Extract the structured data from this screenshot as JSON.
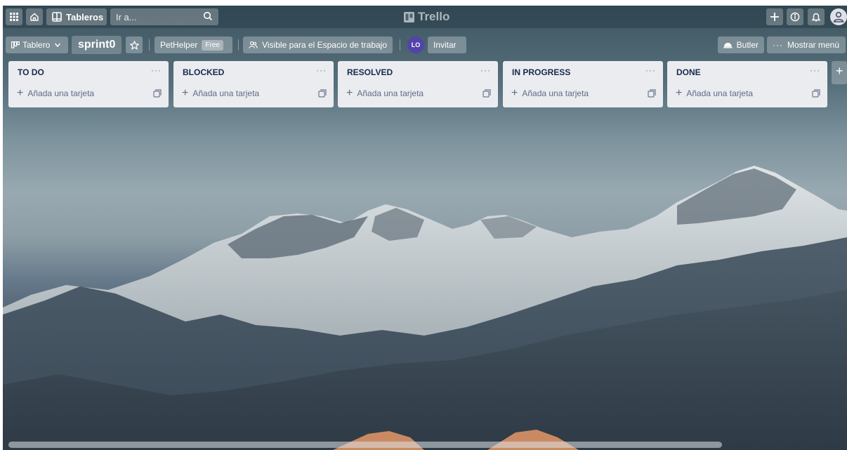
{
  "app": {
    "logo_text": "Trello"
  },
  "topbar": {
    "apps_icon": "grid-icon",
    "home_icon": "home-icon",
    "boards_label": "Tableros",
    "search_placeholder": "Ir a...",
    "create_icon": "plus-icon",
    "info_icon": "info-icon",
    "notifications_icon": "bell-icon",
    "avatar_icon": "user-icon"
  },
  "board_header": {
    "view_label": "Tablero",
    "board_name": "sprint0",
    "workspace_name": "PetHelper",
    "workspace_badge": "Free",
    "visibility_label": "Visible para el Espacio de trabajo",
    "member_initials": "LO",
    "invite_label": "Invitar",
    "butler_label": "Butler",
    "show_menu_label": "Mostrar menú"
  },
  "lists": [
    {
      "title": "TO DO",
      "add_card": "Añada una tarjeta"
    },
    {
      "title": "BLOCKED",
      "add_card": "Añada una tarjeta"
    },
    {
      "title": "RESOLVED",
      "add_card": "Añada una tarjeta"
    },
    {
      "title": "IN PROGRESS",
      "add_card": "Añada una tarjeta"
    },
    {
      "title": "DONE",
      "add_card": "Añada una tarjeta"
    }
  ],
  "add_list_symbol": "+",
  "list_menu_symbol": "···"
}
